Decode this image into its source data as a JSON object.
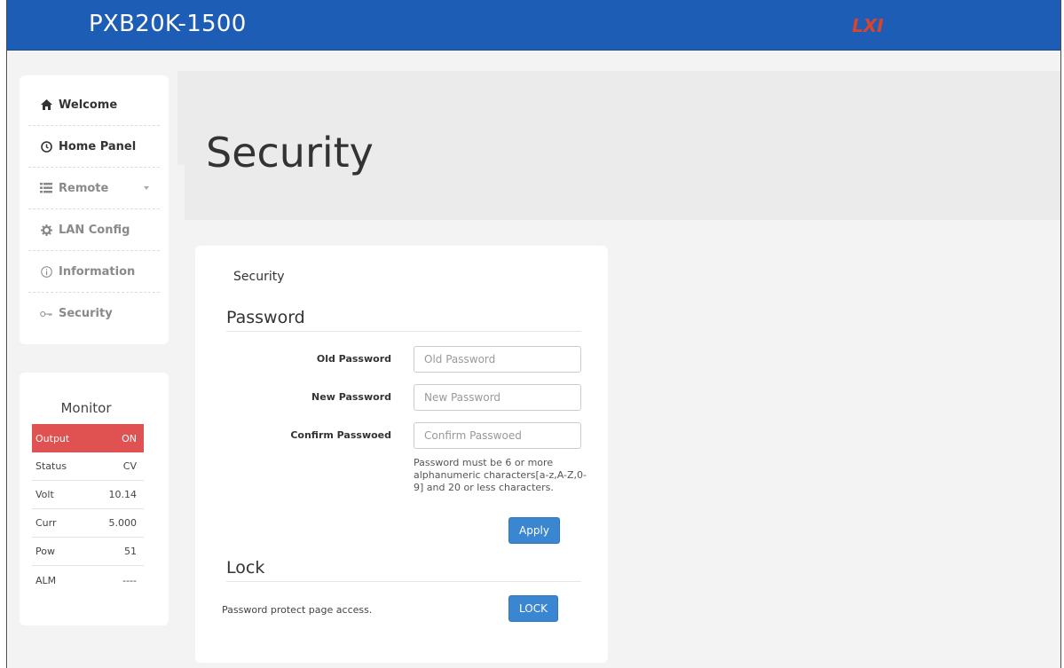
{
  "app": {
    "title": "PXB20K-1500",
    "logo_text": "LXI",
    "brand_color": "#1e5db5"
  },
  "nav": {
    "items": [
      {
        "label": "Welcome",
        "icon": "home-icon"
      },
      {
        "label": "Home Panel",
        "icon": "clock-icon"
      },
      {
        "label": "Remote",
        "icon": "list-icon"
      },
      {
        "label": "LAN Config",
        "icon": "gear-icon"
      },
      {
        "label": "Information",
        "icon": "info-icon"
      },
      {
        "label": "Security",
        "icon": "key-icon"
      }
    ]
  },
  "monitor": {
    "title": "Monitor",
    "rows": [
      {
        "label": "Output",
        "value": "ON"
      },
      {
        "label": "Status",
        "value": "CV"
      },
      {
        "label": "Volt",
        "value": "10.14"
      },
      {
        "label": "Curr",
        "value": "5.000"
      },
      {
        "label": "Pow",
        "value": "51"
      },
      {
        "label": "ALM",
        "value": "----"
      }
    ]
  },
  "page": {
    "heading": "Security"
  },
  "card": {
    "title": "Security",
    "password_heading": "Password",
    "old_password": {
      "label": "Old Password",
      "placeholder": "Old Password",
      "value": ""
    },
    "new_password": {
      "label": "New Password",
      "placeholder": "New Password",
      "value": ""
    },
    "confirm_password": {
      "label": "Confirm Passwoed",
      "placeholder": "Confirm Passwoed",
      "value": ""
    },
    "hint": "Password must be 6 or more alphanumeric characters[a-z,A-Z,0-9] and 20 or less characters.",
    "apply_label": "Apply",
    "lock_heading": "Lock",
    "lock_text": "Password protect page access.",
    "lock_label": "LOCK"
  }
}
